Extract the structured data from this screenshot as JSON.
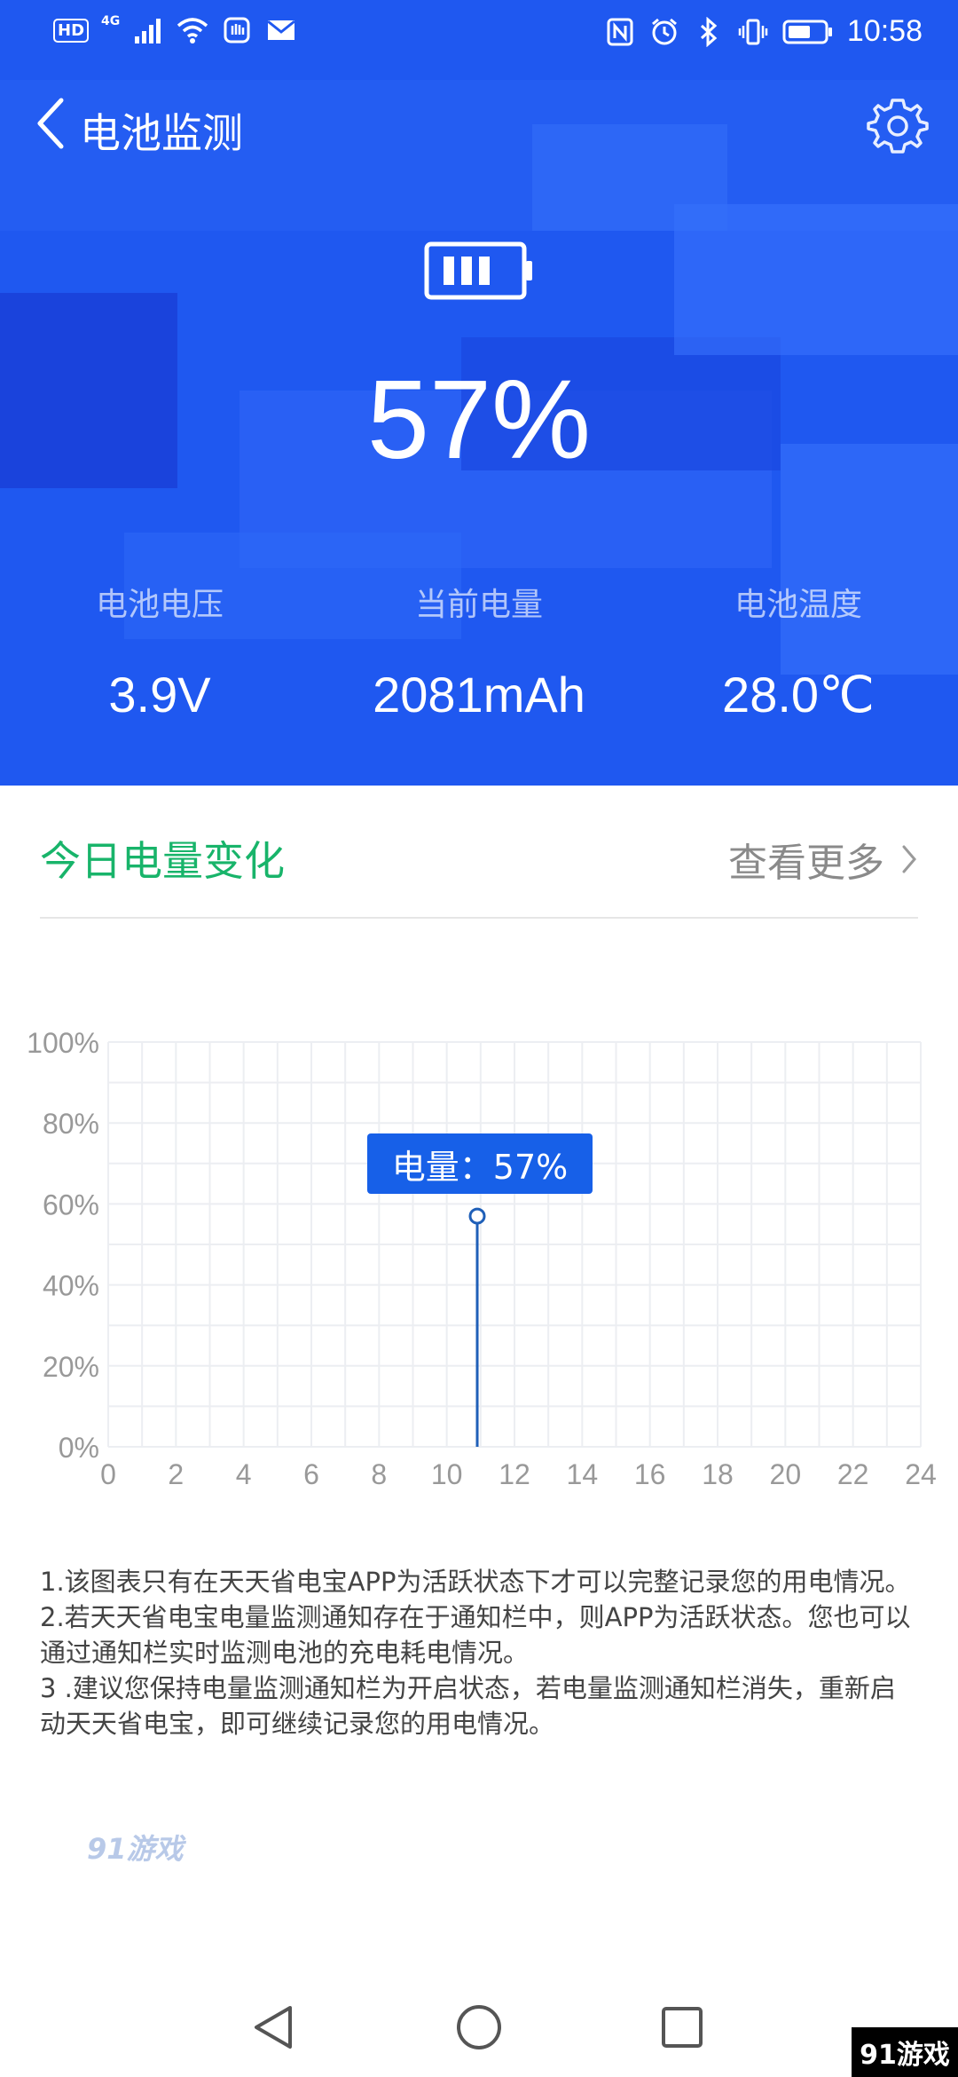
{
  "status_bar": {
    "hd": "HD",
    "network": "4G",
    "time": "10:58"
  },
  "title_bar": {
    "title": "电池监测"
  },
  "battery": {
    "level_fraction": 0.57,
    "percent_text": "57%"
  },
  "stats": [
    {
      "label": "电池电压",
      "value": "3.9V"
    },
    {
      "label": "当前电量",
      "value": "2081mAh"
    },
    {
      "label": "电池温度",
      "value": "28.0℃"
    }
  ],
  "today_section": {
    "title": "今日电量变化",
    "more_label": "查看更多"
  },
  "chart_data": {
    "type": "line",
    "x_ticks": [
      "0",
      "2",
      "4",
      "6",
      "8",
      "10",
      "12",
      "14",
      "16",
      "18",
      "20",
      "22",
      "24"
    ],
    "y_ticks": [
      "0%",
      "20%",
      "40%",
      "60%",
      "80%",
      "100%"
    ],
    "xlim": [
      0,
      24
    ],
    "ylim": [
      0,
      100
    ],
    "grid": true,
    "series": [
      {
        "x": [
          10.9,
          10.9
        ],
        "y": [
          0,
          57
        ]
      }
    ],
    "tooltip": "电量：57%"
  },
  "notes": [
    "1.该图表只有在天天省电宝APP为活跃状态下才可以完整记录您的用电情况。",
    "2.若天天省电宝电量监测通知存在于通知栏中，则APP为活跃状态。您也可以通过通知栏实时监测电池的充电耗电情况。",
    "3 .建议您保持电量监测通知栏为开启状态，若电量监测通知栏消失，重新启动天天省电宝，即可继续记录您的用电情况。"
  ],
  "watermark": "91游戏",
  "corner_logo": "91游戏",
  "colors": {
    "header_bg": "#1f58f0",
    "accent_green": "#18b46a",
    "tooltip_bg": "#1760e8",
    "line": "#1f5fb8"
  }
}
